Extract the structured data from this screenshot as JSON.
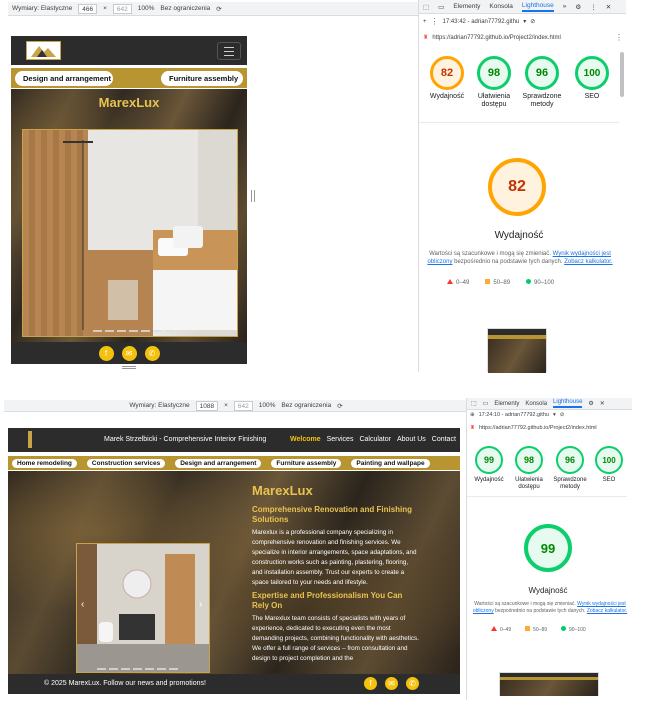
{
  "top": {
    "devbar": {
      "dimensions_label": "Wymiary: Elastyczne",
      "width": "466",
      "height": "642",
      "zoom": "100%",
      "throttle": "Bez ograniczenia"
    },
    "tabs": [
      "Elementy",
      "Konsola",
      "Lighthouse"
    ],
    "lighthouse": {
      "report_label": "17:43:42 - adrian77792.githu",
      "url": "https://adrian77792.github.io/Project2/index.html",
      "scores": [
        {
          "value": "82",
          "label": "Wydajność"
        },
        {
          "value": "98",
          "label": "Ułatwienia dostępu"
        },
        {
          "value": "96",
          "label": "Sprawdzone metody"
        },
        {
          "value": "100",
          "label": "SEO"
        }
      ],
      "big_score": "82",
      "big_label": "Wydajność",
      "note_pre": "Wartości są szacunkowe i mogą się zmieniać.",
      "note_link1": "Wynik wydajności jest obliczony",
      "note_mid": "bezpośrednio na podstawie tych danych.",
      "note_link2": "Zobacz kalkulator.",
      "legend": [
        "0–49",
        "50–89",
        "90–100"
      ]
    },
    "site": {
      "pills": [
        "Design and arrangement",
        "Furniture assembly"
      ],
      "brand": "MarexLux"
    }
  },
  "bottom": {
    "devbar": {
      "dimensions_label": "Wymiary: Elastyczne",
      "width": "1088",
      "height": "642",
      "zoom": "100%",
      "throttle": "Bez ograniczenia"
    },
    "tabs": [
      "Elementy",
      "Konsola",
      "Lighthouse"
    ],
    "lighthouse": {
      "report_label": "17:24:10 - adrian77792.githu",
      "url": "https://adrian77792.github.io/Project2/index.html",
      "scores": [
        {
          "value": "99",
          "label": "Wydajność"
        },
        {
          "value": "98",
          "label": "Ułatwienia dostępu"
        },
        {
          "value": "96",
          "label": "Sprawdzone metody"
        },
        {
          "value": "100",
          "label": "SEO"
        }
      ],
      "big_score": "99",
      "big_label": "Wydajność",
      "note_pre": "Wartości są szacunkowe i mogą się zmieniać.",
      "note_link1": "Wynik wydajności jest obliczony",
      "note_mid": "bezpośrednio na podstawie tych danych.",
      "note_link2": "Zobacz kalkulator.",
      "legend": [
        "0–49",
        "50–89",
        "90–100"
      ]
    },
    "site": {
      "owner": "Marek Strzelbicki - Comprehensive Interior Finishing",
      "nav": [
        "Welcome",
        "Services",
        "Calculator",
        "About Us",
        "Contact"
      ],
      "pills": [
        "Home remodeling",
        "Construction services",
        "Design and arrangement",
        "Furniture assembly",
        "Painting and wallpape"
      ],
      "brand": "MarexLux",
      "heading1": "Comprehensive Renovation and Finishing Solutions",
      "para1": "Marexlux is a professional company specializing in comprehensive renovation and finishing services. We specialize in interior arrangements, space adaptations, and construction works such as painting, plastering, flooring, and installation assembly. Trust our experts to create a space tailored to your needs and lifestyle.",
      "heading2": "Expertise and Professionalism You Can Rely On",
      "para2": "The Marexlux team consists of specialists with years of experience, dedicated to executing even the most demanding projects, combining functionality with aesthetics. We offer a full range of services – from consultation and design to project completion and the",
      "footer": "© 2025 MarexLux. Follow our news and promotions!"
    }
  },
  "colors": {
    "accent_gold": "#e8c352",
    "strip_gold": "#b89530",
    "score_orange": "#ffa400",
    "score_green": "#0cce6b",
    "lh_blue": "#1a73e8"
  }
}
